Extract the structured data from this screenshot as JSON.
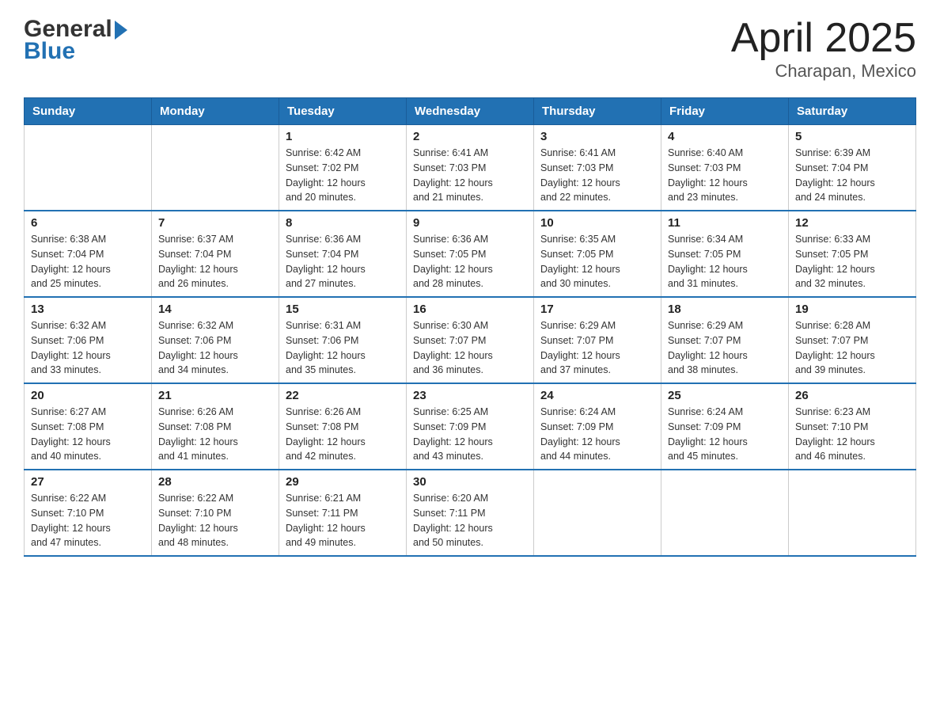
{
  "header": {
    "logo_general": "General",
    "logo_blue": "Blue",
    "title": "April 2025",
    "subtitle": "Charapan, Mexico"
  },
  "calendar": {
    "days_of_week": [
      "Sunday",
      "Monday",
      "Tuesday",
      "Wednesday",
      "Thursday",
      "Friday",
      "Saturday"
    ],
    "weeks": [
      [
        {
          "day": "",
          "info": ""
        },
        {
          "day": "",
          "info": ""
        },
        {
          "day": "1",
          "info": "Sunrise: 6:42 AM\nSunset: 7:02 PM\nDaylight: 12 hours\nand 20 minutes."
        },
        {
          "day": "2",
          "info": "Sunrise: 6:41 AM\nSunset: 7:03 PM\nDaylight: 12 hours\nand 21 minutes."
        },
        {
          "day": "3",
          "info": "Sunrise: 6:41 AM\nSunset: 7:03 PM\nDaylight: 12 hours\nand 22 minutes."
        },
        {
          "day": "4",
          "info": "Sunrise: 6:40 AM\nSunset: 7:03 PM\nDaylight: 12 hours\nand 23 minutes."
        },
        {
          "day": "5",
          "info": "Sunrise: 6:39 AM\nSunset: 7:04 PM\nDaylight: 12 hours\nand 24 minutes."
        }
      ],
      [
        {
          "day": "6",
          "info": "Sunrise: 6:38 AM\nSunset: 7:04 PM\nDaylight: 12 hours\nand 25 minutes."
        },
        {
          "day": "7",
          "info": "Sunrise: 6:37 AM\nSunset: 7:04 PM\nDaylight: 12 hours\nand 26 minutes."
        },
        {
          "day": "8",
          "info": "Sunrise: 6:36 AM\nSunset: 7:04 PM\nDaylight: 12 hours\nand 27 minutes."
        },
        {
          "day": "9",
          "info": "Sunrise: 6:36 AM\nSunset: 7:05 PM\nDaylight: 12 hours\nand 28 minutes."
        },
        {
          "day": "10",
          "info": "Sunrise: 6:35 AM\nSunset: 7:05 PM\nDaylight: 12 hours\nand 30 minutes."
        },
        {
          "day": "11",
          "info": "Sunrise: 6:34 AM\nSunset: 7:05 PM\nDaylight: 12 hours\nand 31 minutes."
        },
        {
          "day": "12",
          "info": "Sunrise: 6:33 AM\nSunset: 7:05 PM\nDaylight: 12 hours\nand 32 minutes."
        }
      ],
      [
        {
          "day": "13",
          "info": "Sunrise: 6:32 AM\nSunset: 7:06 PM\nDaylight: 12 hours\nand 33 minutes."
        },
        {
          "day": "14",
          "info": "Sunrise: 6:32 AM\nSunset: 7:06 PM\nDaylight: 12 hours\nand 34 minutes."
        },
        {
          "day": "15",
          "info": "Sunrise: 6:31 AM\nSunset: 7:06 PM\nDaylight: 12 hours\nand 35 minutes."
        },
        {
          "day": "16",
          "info": "Sunrise: 6:30 AM\nSunset: 7:07 PM\nDaylight: 12 hours\nand 36 minutes."
        },
        {
          "day": "17",
          "info": "Sunrise: 6:29 AM\nSunset: 7:07 PM\nDaylight: 12 hours\nand 37 minutes."
        },
        {
          "day": "18",
          "info": "Sunrise: 6:29 AM\nSunset: 7:07 PM\nDaylight: 12 hours\nand 38 minutes."
        },
        {
          "day": "19",
          "info": "Sunrise: 6:28 AM\nSunset: 7:07 PM\nDaylight: 12 hours\nand 39 minutes."
        }
      ],
      [
        {
          "day": "20",
          "info": "Sunrise: 6:27 AM\nSunset: 7:08 PM\nDaylight: 12 hours\nand 40 minutes."
        },
        {
          "day": "21",
          "info": "Sunrise: 6:26 AM\nSunset: 7:08 PM\nDaylight: 12 hours\nand 41 minutes."
        },
        {
          "day": "22",
          "info": "Sunrise: 6:26 AM\nSunset: 7:08 PM\nDaylight: 12 hours\nand 42 minutes."
        },
        {
          "day": "23",
          "info": "Sunrise: 6:25 AM\nSunset: 7:09 PM\nDaylight: 12 hours\nand 43 minutes."
        },
        {
          "day": "24",
          "info": "Sunrise: 6:24 AM\nSunset: 7:09 PM\nDaylight: 12 hours\nand 44 minutes."
        },
        {
          "day": "25",
          "info": "Sunrise: 6:24 AM\nSunset: 7:09 PM\nDaylight: 12 hours\nand 45 minutes."
        },
        {
          "day": "26",
          "info": "Sunrise: 6:23 AM\nSunset: 7:10 PM\nDaylight: 12 hours\nand 46 minutes."
        }
      ],
      [
        {
          "day": "27",
          "info": "Sunrise: 6:22 AM\nSunset: 7:10 PM\nDaylight: 12 hours\nand 47 minutes."
        },
        {
          "day": "28",
          "info": "Sunrise: 6:22 AM\nSunset: 7:10 PM\nDaylight: 12 hours\nand 48 minutes."
        },
        {
          "day": "29",
          "info": "Sunrise: 6:21 AM\nSunset: 7:11 PM\nDaylight: 12 hours\nand 49 minutes."
        },
        {
          "day": "30",
          "info": "Sunrise: 6:20 AM\nSunset: 7:11 PM\nDaylight: 12 hours\nand 50 minutes."
        },
        {
          "day": "",
          "info": ""
        },
        {
          "day": "",
          "info": ""
        },
        {
          "day": "",
          "info": ""
        }
      ]
    ]
  }
}
